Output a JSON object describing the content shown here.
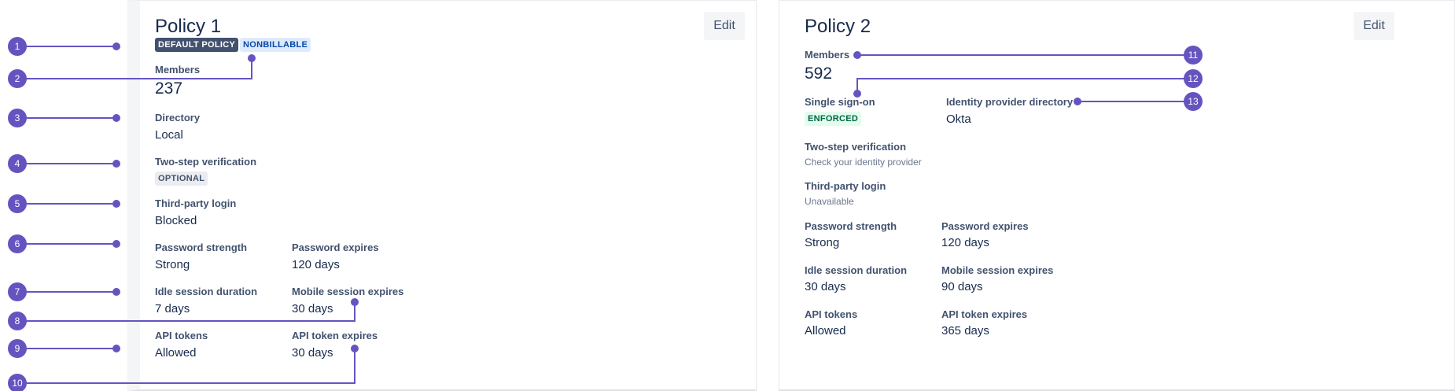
{
  "policy1": {
    "title": "Policy 1",
    "edit_label": "Edit",
    "badges": {
      "default": "DEFAULT POLICY",
      "nonbillable": "NONBILLABLE"
    },
    "members_label": "Members",
    "members_value": "237",
    "directory_label": "Directory",
    "directory_value": "Local",
    "two_step_label": "Two-step verification",
    "two_step_value": "OPTIONAL",
    "third_party_label": "Third-party login",
    "third_party_value": "Blocked",
    "password_strength_label": "Password strength",
    "password_strength_value": "Strong",
    "password_expires_label": "Password expires",
    "password_expires_value": "120 days",
    "idle_label": "Idle session duration",
    "idle_value": "7 days",
    "mobile_label": "Mobile session expires",
    "mobile_value": "30 days",
    "api_tokens_label": "API tokens",
    "api_tokens_value": "Allowed",
    "api_expires_label": "API token expires",
    "api_expires_value": "30 days"
  },
  "policy2": {
    "title": "Policy 2",
    "edit_label": "Edit",
    "members_label": "Members",
    "members_value": "592",
    "sso_label": "Single sign-on",
    "sso_value": "ENFORCED",
    "idp_label": "Identity provider directory",
    "idp_value": "Okta",
    "two_step_label": "Two-step verification",
    "two_step_value": "Check your identity provider",
    "third_party_label": "Third-party login",
    "third_party_value": "Unavailable",
    "password_strength_label": "Password strength",
    "password_strength_value": "Strong",
    "password_expires_label": "Password expires",
    "password_expires_value": "120 days",
    "idle_label": "Idle session duration",
    "idle_value": "30 days",
    "mobile_label": "Mobile session expires",
    "mobile_value": "90 days",
    "api_tokens_label": "API tokens",
    "api_tokens_value": "Allowed",
    "api_expires_label": "API token expires",
    "api_expires_value": "365 days"
  },
  "callouts": [
    "1",
    "2",
    "3",
    "4",
    "5",
    "6",
    "7",
    "8",
    "9",
    "10",
    "11",
    "12",
    "13"
  ],
  "colors": {
    "callout": "#6554c0",
    "default_badge_bg": "#42526e",
    "nonbillable_bg": "#deebff",
    "nonbillable_fg": "#0747a6",
    "optional_bg": "#ebecf0",
    "enforced_bg": "#e3fcef",
    "enforced_fg": "#006644"
  }
}
